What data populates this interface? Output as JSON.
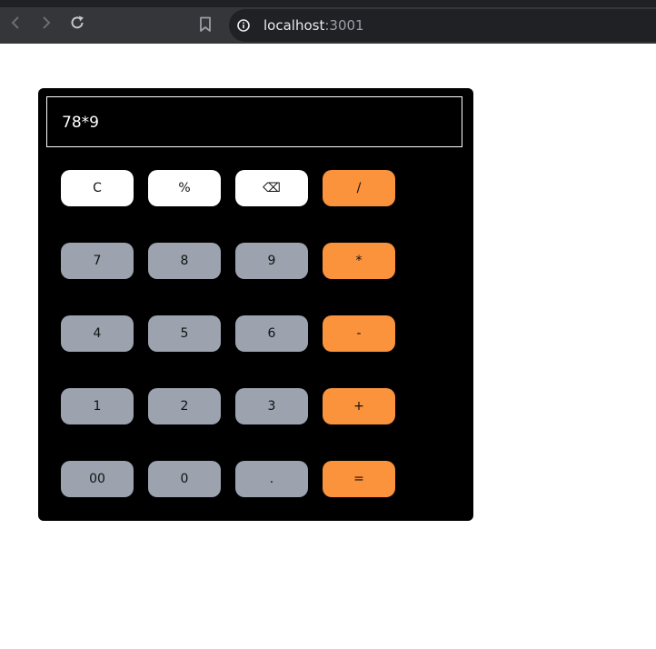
{
  "browser": {
    "url_host": "localhost",
    "url_port": ":3001",
    "icons": {
      "back": "back-arrow-icon",
      "forward": "forward-arrow-icon",
      "reload": "reload-icon",
      "bookmark": "bookmark-icon",
      "info": "info-icon"
    }
  },
  "calculator": {
    "display": "78*9",
    "rows": [
      [
        {
          "label": "C",
          "kind": "fn"
        },
        {
          "label": "%",
          "kind": "fn"
        },
        {
          "label": "⌫",
          "kind": "fn"
        },
        {
          "label": "/",
          "kind": "op"
        }
      ],
      [
        {
          "label": "7",
          "kind": "num"
        },
        {
          "label": "8",
          "kind": "num"
        },
        {
          "label": "9",
          "kind": "num"
        },
        {
          "label": "*",
          "kind": "op"
        }
      ],
      [
        {
          "label": "4",
          "kind": "num"
        },
        {
          "label": "5",
          "kind": "num"
        },
        {
          "label": "6",
          "kind": "num"
        },
        {
          "label": "-",
          "kind": "op"
        }
      ],
      [
        {
          "label": "1",
          "kind": "num"
        },
        {
          "label": "2",
          "kind": "num"
        },
        {
          "label": "3",
          "kind": "num"
        },
        {
          "label": "+",
          "kind": "op"
        }
      ],
      [
        {
          "label": "00",
          "kind": "num"
        },
        {
          "label": "0",
          "kind": "num"
        },
        {
          "label": ".",
          "kind": "num"
        },
        {
          "label": "=",
          "kind": "op"
        }
      ]
    ]
  },
  "colors": {
    "function_key": "#ffffff",
    "number_key": "#9ca3af",
    "operator_key": "#fb923c",
    "calculator_body": "#000000"
  }
}
